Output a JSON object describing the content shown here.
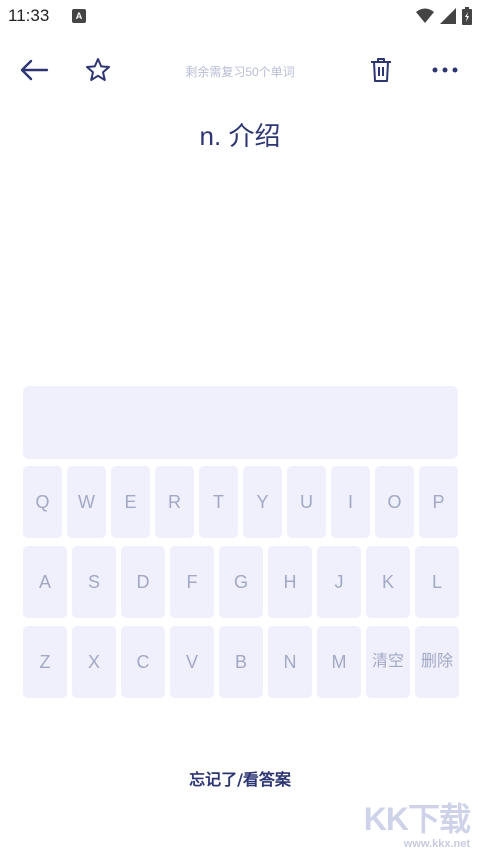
{
  "status_bar": {
    "time": "11:33",
    "notification_icon": "A",
    "icons": [
      "wifi-icon",
      "signal-icon",
      "battery-icon"
    ]
  },
  "toolbar": {
    "remaining_text": "剩余需复习50个单词",
    "icons": [
      "back-arrow-icon",
      "star-icon",
      "trash-icon",
      "more-icon"
    ]
  },
  "word": {
    "definition": "n. 介绍"
  },
  "answer": {
    "value": ""
  },
  "keyboard": {
    "row1": [
      "Q",
      "W",
      "E",
      "R",
      "T",
      "Y",
      "U",
      "I",
      "O",
      "P"
    ],
    "row2": [
      "A",
      "S",
      "D",
      "F",
      "G",
      "H",
      "J",
      "K",
      "L"
    ],
    "row3": [
      "Z",
      "X",
      "C",
      "V",
      "B",
      "N",
      "M",
      "清空",
      "删除"
    ]
  },
  "footer": {
    "forgot_label": "忘记了/看答案"
  },
  "watermark": {
    "title": "KK下载",
    "url": "www.kkx.net"
  },
  "colors": {
    "primary": "#2d3572",
    "key_bg": "#eff0fc",
    "key_text": "#a3a8c5",
    "muted": "#b9bdd6"
  }
}
